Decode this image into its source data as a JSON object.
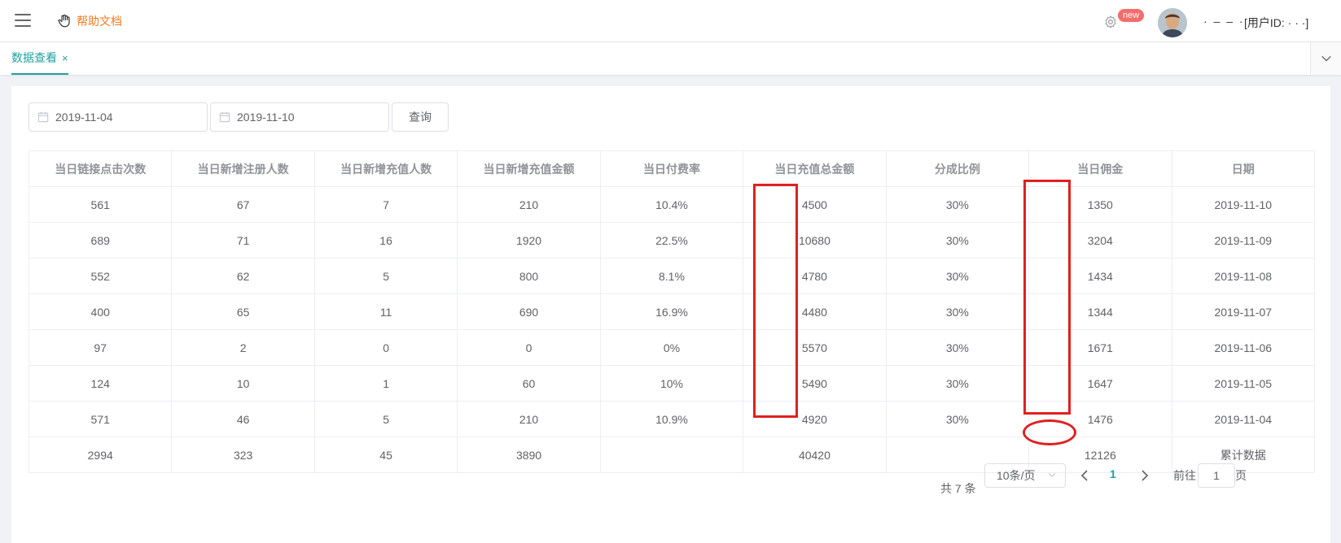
{
  "header": {
    "help_label": "帮助文档",
    "badge": "new",
    "username": "· – – ·",
    "userid": "[用户ID: ·  · ·]"
  },
  "tabs": [
    {
      "label": "数据查看",
      "close": "×"
    }
  ],
  "filters": {
    "start_date": "2019-11-04",
    "end_date": "2019-11-10",
    "query_label": "查询"
  },
  "table": {
    "columns": [
      "当日链接点击次数",
      "当日新增注册人数",
      "当日新增充值人数",
      "当日新增充值金额",
      "当日付费率",
      "当日充值总金额",
      "分成比例",
      "当日佣金",
      "日期"
    ],
    "rows": [
      [
        "561",
        "67",
        "7",
        "210",
        "10.4%",
        "4500",
        "30%",
        "1350",
        "2019-11-10"
      ],
      [
        "689",
        "71",
        "16",
        "1920",
        "22.5%",
        "10680",
        "30%",
        "3204",
        "2019-11-09"
      ],
      [
        "552",
        "62",
        "5",
        "800",
        "8.1%",
        "4780",
        "30%",
        "1434",
        "2019-11-08"
      ],
      [
        "400",
        "65",
        "11",
        "690",
        "16.9%",
        "4480",
        "30%",
        "1344",
        "2019-11-07"
      ],
      [
        "97",
        "2",
        "0",
        "0",
        "0%",
        "5570",
        "30%",
        "1671",
        "2019-11-06"
      ],
      [
        "124",
        "10",
        "1",
        "60",
        "10%",
        "5490",
        "30%",
        "1647",
        "2019-11-05"
      ],
      [
        "571",
        "46",
        "5",
        "210",
        "10.9%",
        "4920",
        "30%",
        "1476",
        "2019-11-04"
      ],
      [
        "2994",
        "323",
        "45",
        "3890",
        "",
        "40420",
        "",
        "12126",
        "累计数据"
      ]
    ]
  },
  "pagination": {
    "total_label": "共 7 条",
    "page_size_label": "10条/页",
    "current_page": "1",
    "goto_label": "前往",
    "goto_value": "1",
    "unit_label": "页"
  },
  "colors": {
    "accent": "#20a0a0",
    "help": "#f47b20",
    "badge": "#f56c6c",
    "annotation": "#e02020"
  }
}
